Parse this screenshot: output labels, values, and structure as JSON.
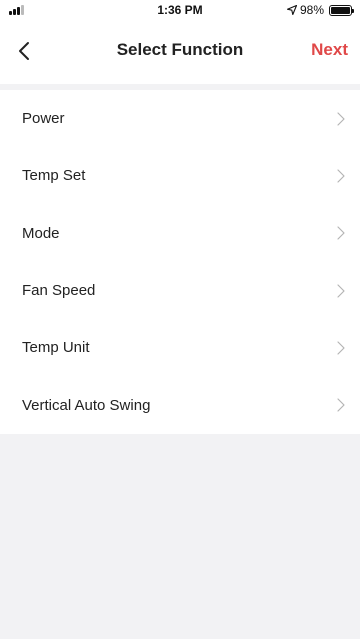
{
  "status_bar": {
    "time": "1:36 PM",
    "battery": "98%"
  },
  "nav": {
    "title": "Select Function",
    "next_label": "Next"
  },
  "colors": {
    "accent": "#e04848",
    "background": "#f2f2f4"
  },
  "functions": [
    {
      "label": "Power"
    },
    {
      "label": "Temp Set"
    },
    {
      "label": "Mode"
    },
    {
      "label": "Fan Speed"
    },
    {
      "label": "Temp Unit"
    },
    {
      "label": "Vertical Auto Swing"
    }
  ]
}
